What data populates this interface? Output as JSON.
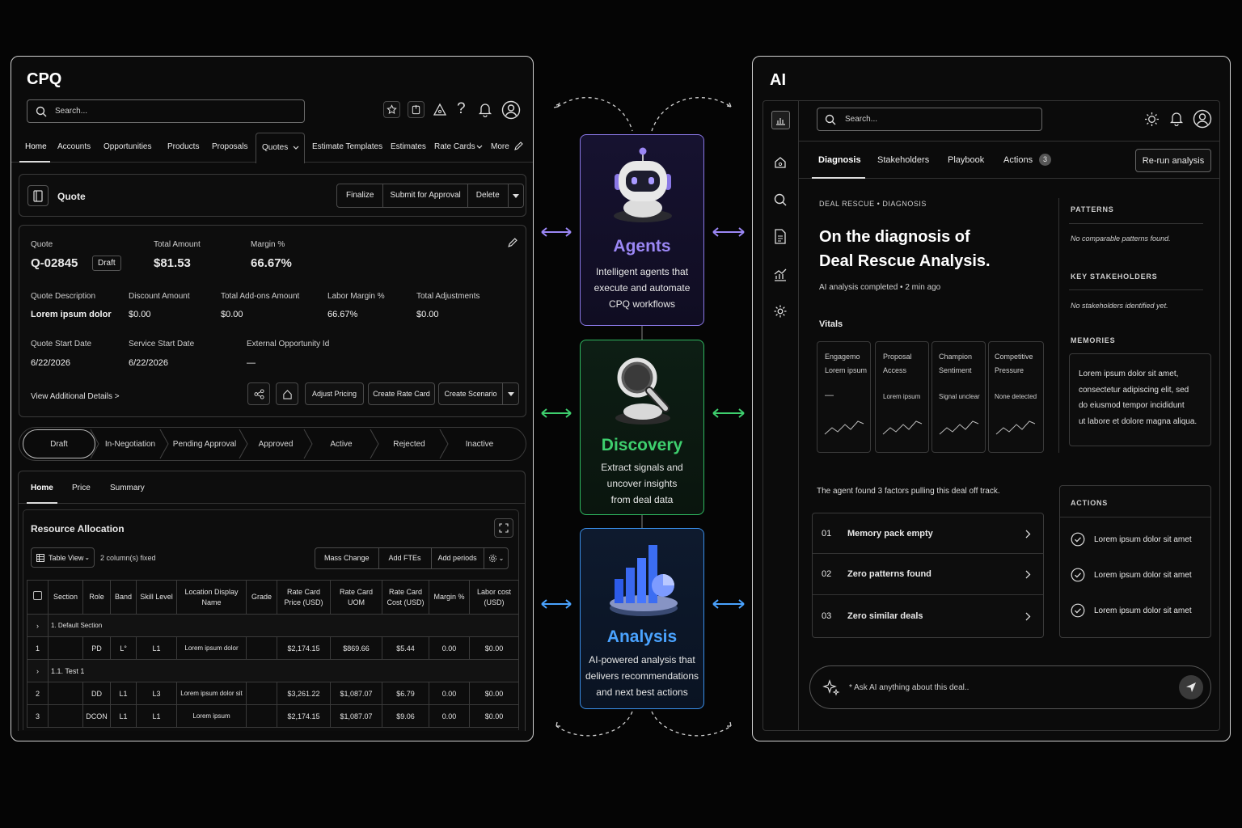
{
  "cpq": {
    "title": "CPQ",
    "search_placeholder": "Search...",
    "nav": [
      "Home",
      "Accounts",
      "Opportunities",
      "Products",
      "Proposals",
      "Quotes",
      "Estimate Templates",
      "Estimates",
      "Rate Cards",
      "More"
    ],
    "quote_header": {
      "label": "Quote",
      "buttons": [
        "Finalize",
        "Submit for Approval",
        "Delete"
      ]
    },
    "details": {
      "quote_label": "Quote",
      "quote_value": "Q-02845",
      "status_badge": "Draft",
      "total_amount_label": "Total Amount",
      "total_amount_value": "$81.53",
      "margin_label": "Margin %",
      "margin_value": "66.67%",
      "quote_description_label": "Quote Description",
      "quote_description_value": "Lorem ipsum dolor",
      "discount_amount_label": "Discount Amount",
      "discount_amount_value": "$0.00",
      "total_addons_label": "Total Add-ons Amount",
      "total_addons_value": "$0.00",
      "labor_margin_label": "Labor Margin %",
      "labor_margin_value": "66.67%",
      "total_adjustments_label": "Total Adjustments",
      "total_adjustments_value": "$0.00",
      "quote_start_label": "Quote Start Date",
      "quote_start_value": "6/22/2026",
      "service_start_label": "Service Start Date",
      "service_start_value": "6/22/2026",
      "external_opp_label": "External Opportunity Id",
      "external_opp_value": "—",
      "view_more": "View Additional Details >",
      "action_buttons": [
        "Adjust Pricing",
        "Create Rate Card",
        "Create Scenario"
      ]
    },
    "stages": [
      "Draft",
      "In-Negotiation",
      "Pending Approval",
      "Approved",
      "Active",
      "Rejected",
      "Inactive"
    ],
    "subtabs": [
      "Home",
      "Price",
      "Summary"
    ],
    "resource": {
      "title": "Resource Allocation",
      "view": "Table View",
      "fixed": "2 column(s) fixed",
      "buttons": [
        "Mass Change",
        "Add FTEs",
        "Add periods"
      ],
      "columns": [
        "Section",
        "Role",
        "Band",
        "Skill Level",
        "Location Display Name",
        "Grade",
        "Rate Card Price (USD)",
        "Rate Card UOM",
        "Rate Card Cost (USD)",
        "Margin %",
        "Labor cost (USD)"
      ],
      "section1": "1. Default Section",
      "section2": "1.1. Test 1",
      "rows": [
        {
          "n": "1",
          "role": "PD",
          "band": "L°",
          "skill": "L1",
          "loc": "Lorem ipsum dolor",
          "price": "$2,174.15",
          "uom": "$869.66",
          "cost": "$5.44",
          "margin": "0.00",
          "labor": "$0.00"
        },
        {
          "n": "2",
          "role": "DD",
          "band": "L1",
          "skill": "L3",
          "loc": "Lorem ipsum dolor sit",
          "price": "$3,261.22",
          "uom": "$1,087.07",
          "cost": "$6.79",
          "margin": "0.00",
          "labor": "$0.00"
        },
        {
          "n": "3",
          "role": "DCON",
          "band": "L1",
          "skill": "L1",
          "loc": "Lorem ipsum",
          "price": "$2,174.15",
          "uom": "$1,087.07",
          "cost": "$9.06",
          "margin": "0.00",
          "labor": "$0.00"
        }
      ]
    }
  },
  "center": {
    "agents": {
      "title": "Agents",
      "desc": [
        "Intelligent agents that",
        "execute and automate",
        "CPQ workflows"
      ],
      "color": "#9b87f5"
    },
    "discovery": {
      "title": "Discovery",
      "desc": [
        "Extract signals and",
        "uncover insights",
        "from deal data"
      ],
      "color": "#3ecf6e"
    },
    "analysis": {
      "title": "Analysis",
      "desc": [
        "AI-powered analysis that",
        "delivers recommendations",
        "and next best actions"
      ],
      "color": "#4aa3ff"
    }
  },
  "ai": {
    "title": "AI",
    "search_placeholder": "Search...",
    "tabs": [
      "Diagnosis",
      "Stakeholders",
      "Playbook",
      "Actions"
    ],
    "actions_count": "3",
    "rerun": "Re-run analysis",
    "eyebrow": "DEAL RESCUE • DIAGNOSIS",
    "heading": [
      "On the diagnosis of",
      "Deal Rescue Analysis."
    ],
    "completed": "AI analysis completed • 2 min ago",
    "vitals_label": "Vitals",
    "vitals": [
      {
        "title": [
          "Engagemo",
          "Lorem ipsum"
        ],
        "value": "—"
      },
      {
        "title": [
          "Proposal",
          "Access"
        ],
        "value": "Lorem ipsum"
      },
      {
        "title": [
          "Champion",
          "Sentiment"
        ],
        "value": "Signal unclear"
      },
      {
        "title": [
          "Competitive",
          "Pressure"
        ],
        "value": "None detected"
      }
    ],
    "factors_intro": "The agent found 3 factors pulling this deal off track.",
    "factors": [
      {
        "n": "01",
        "label": "Memory pack empty"
      },
      {
        "n": "02",
        "label": "Zero patterns found"
      },
      {
        "n": "03",
        "label": "Zero similar deals"
      }
    ],
    "patterns": {
      "title": "PATTERNS",
      "text": "No comparable patterns found."
    },
    "key_stakeholders": {
      "title": "KEY STAKEHOLDERS",
      "text": "No stakeholders identified yet."
    },
    "memories": {
      "title": "MEMORIES",
      "text": [
        "Lorem ipsum dolor sit amet,",
        "consectetur adipiscing elit, sed",
        "do eiusmod tempor incididunt",
        "ut labore et dolore magna aliqua."
      ]
    },
    "actions_panel": {
      "title": "ACTIONS",
      "items": [
        "Lorem ipsum dolor sit amet",
        "Lorem ipsum dolor sit amet",
        "Lorem ipsum dolor sit amet"
      ]
    },
    "ask_placeholder": "* Ask AI anything about this deal.."
  }
}
